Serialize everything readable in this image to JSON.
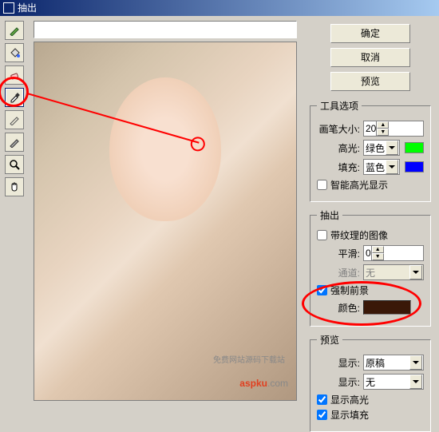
{
  "title": "抽出",
  "buttons": {
    "ok": "确定",
    "cancel": "取消",
    "preview": "预览"
  },
  "toolOptions": {
    "legend": "工具选项",
    "brushSize": {
      "label": "画笔大小:",
      "value": "20"
    },
    "highlight": {
      "label": "高光:",
      "value": "绿色",
      "swatch": "#00ff00"
    },
    "fill": {
      "label": "填充:",
      "value": "蓝色",
      "swatch": "#0000ff"
    },
    "smartHighlight": {
      "label": "智能高光显示",
      "checked": false
    }
  },
  "extract": {
    "legend": "抽出",
    "textured": {
      "label": "带纹理的图像",
      "checked": false
    },
    "smooth": {
      "label": "平滑:",
      "value": "0"
    },
    "channel": {
      "label": "通道:",
      "value": "无"
    },
    "forceFg": {
      "label": "强制前景",
      "checked": true
    },
    "color": {
      "label": "颜色:",
      "value": "#3a1808"
    }
  },
  "previewSection": {
    "legend": "预览",
    "show": {
      "label": "显示:",
      "value": "原稿"
    },
    "display": {
      "label": "显示:",
      "value": "无"
    },
    "showHighlight": {
      "label": "显示高光",
      "checked": true
    },
    "showFill": {
      "label": "显示填充",
      "checked": true
    }
  },
  "watermark": {
    "brand": "aspku",
    "suffix": ".com",
    "tagline": "免费网站源码下载站"
  }
}
